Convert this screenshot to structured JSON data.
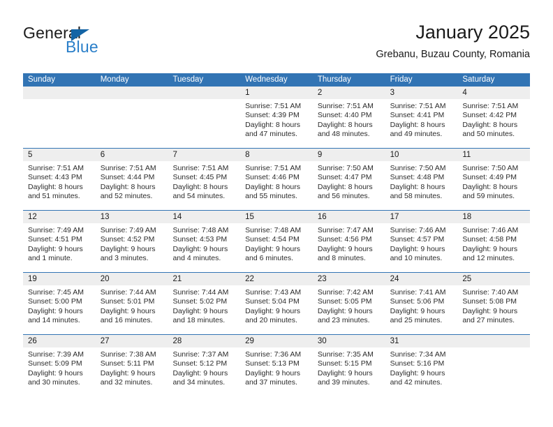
{
  "brand": {
    "name_part1": "General",
    "name_part2": "Blue",
    "triangle_icon": "blue-triangle-icon",
    "accent_color": "#1464a5",
    "blue_text_color": "#2a7fc9"
  },
  "header": {
    "title": "January 2025",
    "subtitle": "Grebanu, Buzau County, Romania"
  },
  "theme": {
    "header_blue": "#3274b4",
    "daynum_gray": "#eeeeee",
    "row_separator": "#3274b4"
  },
  "weekdays": [
    "Sunday",
    "Monday",
    "Tuesday",
    "Wednesday",
    "Thursday",
    "Friday",
    "Saturday"
  ],
  "weeks": [
    [
      {
        "day": "",
        "empty": true
      },
      {
        "day": "",
        "empty": true
      },
      {
        "day": "",
        "empty": true
      },
      {
        "day": "1",
        "sunrise": "Sunrise: 7:51 AM",
        "sunset": "Sunset: 4:39 PM",
        "daylight_1": "Daylight: 8 hours",
        "daylight_2": "and 47 minutes."
      },
      {
        "day": "2",
        "sunrise": "Sunrise: 7:51 AM",
        "sunset": "Sunset: 4:40 PM",
        "daylight_1": "Daylight: 8 hours",
        "daylight_2": "and 48 minutes."
      },
      {
        "day": "3",
        "sunrise": "Sunrise: 7:51 AM",
        "sunset": "Sunset: 4:41 PM",
        "daylight_1": "Daylight: 8 hours",
        "daylight_2": "and 49 minutes."
      },
      {
        "day": "4",
        "sunrise": "Sunrise: 7:51 AM",
        "sunset": "Sunset: 4:42 PM",
        "daylight_1": "Daylight: 8 hours",
        "daylight_2": "and 50 minutes."
      }
    ],
    [
      {
        "day": "5",
        "sunrise": "Sunrise: 7:51 AM",
        "sunset": "Sunset: 4:43 PM",
        "daylight_1": "Daylight: 8 hours",
        "daylight_2": "and 51 minutes."
      },
      {
        "day": "6",
        "sunrise": "Sunrise: 7:51 AM",
        "sunset": "Sunset: 4:44 PM",
        "daylight_1": "Daylight: 8 hours",
        "daylight_2": "and 52 minutes."
      },
      {
        "day": "7",
        "sunrise": "Sunrise: 7:51 AM",
        "sunset": "Sunset: 4:45 PM",
        "daylight_1": "Daylight: 8 hours",
        "daylight_2": "and 54 minutes."
      },
      {
        "day": "8",
        "sunrise": "Sunrise: 7:51 AM",
        "sunset": "Sunset: 4:46 PM",
        "daylight_1": "Daylight: 8 hours",
        "daylight_2": "and 55 minutes."
      },
      {
        "day": "9",
        "sunrise": "Sunrise: 7:50 AM",
        "sunset": "Sunset: 4:47 PM",
        "daylight_1": "Daylight: 8 hours",
        "daylight_2": "and 56 minutes."
      },
      {
        "day": "10",
        "sunrise": "Sunrise: 7:50 AM",
        "sunset": "Sunset: 4:48 PM",
        "daylight_1": "Daylight: 8 hours",
        "daylight_2": "and 58 minutes."
      },
      {
        "day": "11",
        "sunrise": "Sunrise: 7:50 AM",
        "sunset": "Sunset: 4:49 PM",
        "daylight_1": "Daylight: 8 hours",
        "daylight_2": "and 59 minutes."
      }
    ],
    [
      {
        "day": "12",
        "sunrise": "Sunrise: 7:49 AM",
        "sunset": "Sunset: 4:51 PM",
        "daylight_1": "Daylight: 9 hours",
        "daylight_2": "and 1 minute."
      },
      {
        "day": "13",
        "sunrise": "Sunrise: 7:49 AM",
        "sunset": "Sunset: 4:52 PM",
        "daylight_1": "Daylight: 9 hours",
        "daylight_2": "and 3 minutes."
      },
      {
        "day": "14",
        "sunrise": "Sunrise: 7:48 AM",
        "sunset": "Sunset: 4:53 PM",
        "daylight_1": "Daylight: 9 hours",
        "daylight_2": "and 4 minutes."
      },
      {
        "day": "15",
        "sunrise": "Sunrise: 7:48 AM",
        "sunset": "Sunset: 4:54 PM",
        "daylight_1": "Daylight: 9 hours",
        "daylight_2": "and 6 minutes."
      },
      {
        "day": "16",
        "sunrise": "Sunrise: 7:47 AM",
        "sunset": "Sunset: 4:56 PM",
        "daylight_1": "Daylight: 9 hours",
        "daylight_2": "and 8 minutes."
      },
      {
        "day": "17",
        "sunrise": "Sunrise: 7:46 AM",
        "sunset": "Sunset: 4:57 PM",
        "daylight_1": "Daylight: 9 hours",
        "daylight_2": "and 10 minutes."
      },
      {
        "day": "18",
        "sunrise": "Sunrise: 7:46 AM",
        "sunset": "Sunset: 4:58 PM",
        "daylight_1": "Daylight: 9 hours",
        "daylight_2": "and 12 minutes."
      }
    ],
    [
      {
        "day": "19",
        "sunrise": "Sunrise: 7:45 AM",
        "sunset": "Sunset: 5:00 PM",
        "daylight_1": "Daylight: 9 hours",
        "daylight_2": "and 14 minutes."
      },
      {
        "day": "20",
        "sunrise": "Sunrise: 7:44 AM",
        "sunset": "Sunset: 5:01 PM",
        "daylight_1": "Daylight: 9 hours",
        "daylight_2": "and 16 minutes."
      },
      {
        "day": "21",
        "sunrise": "Sunrise: 7:44 AM",
        "sunset": "Sunset: 5:02 PM",
        "daylight_1": "Daylight: 9 hours",
        "daylight_2": "and 18 minutes."
      },
      {
        "day": "22",
        "sunrise": "Sunrise: 7:43 AM",
        "sunset": "Sunset: 5:04 PM",
        "daylight_1": "Daylight: 9 hours",
        "daylight_2": "and 20 minutes."
      },
      {
        "day": "23",
        "sunrise": "Sunrise: 7:42 AM",
        "sunset": "Sunset: 5:05 PM",
        "daylight_1": "Daylight: 9 hours",
        "daylight_2": "and 23 minutes."
      },
      {
        "day": "24",
        "sunrise": "Sunrise: 7:41 AM",
        "sunset": "Sunset: 5:06 PM",
        "daylight_1": "Daylight: 9 hours",
        "daylight_2": "and 25 minutes."
      },
      {
        "day": "25",
        "sunrise": "Sunrise: 7:40 AM",
        "sunset": "Sunset: 5:08 PM",
        "daylight_1": "Daylight: 9 hours",
        "daylight_2": "and 27 minutes."
      }
    ],
    [
      {
        "day": "26",
        "sunrise": "Sunrise: 7:39 AM",
        "sunset": "Sunset: 5:09 PM",
        "daylight_1": "Daylight: 9 hours",
        "daylight_2": "and 30 minutes."
      },
      {
        "day": "27",
        "sunrise": "Sunrise: 7:38 AM",
        "sunset": "Sunset: 5:11 PM",
        "daylight_1": "Daylight: 9 hours",
        "daylight_2": "and 32 minutes."
      },
      {
        "day": "28",
        "sunrise": "Sunrise: 7:37 AM",
        "sunset": "Sunset: 5:12 PM",
        "daylight_1": "Daylight: 9 hours",
        "daylight_2": "and 34 minutes."
      },
      {
        "day": "29",
        "sunrise": "Sunrise: 7:36 AM",
        "sunset": "Sunset: 5:13 PM",
        "daylight_1": "Daylight: 9 hours",
        "daylight_2": "and 37 minutes."
      },
      {
        "day": "30",
        "sunrise": "Sunrise: 7:35 AM",
        "sunset": "Sunset: 5:15 PM",
        "daylight_1": "Daylight: 9 hours",
        "daylight_2": "and 39 minutes."
      },
      {
        "day": "31",
        "sunrise": "Sunrise: 7:34 AM",
        "sunset": "Sunset: 5:16 PM",
        "daylight_1": "Daylight: 9 hours",
        "daylight_2": "and 42 minutes."
      },
      {
        "day": "",
        "empty": true
      }
    ]
  ]
}
